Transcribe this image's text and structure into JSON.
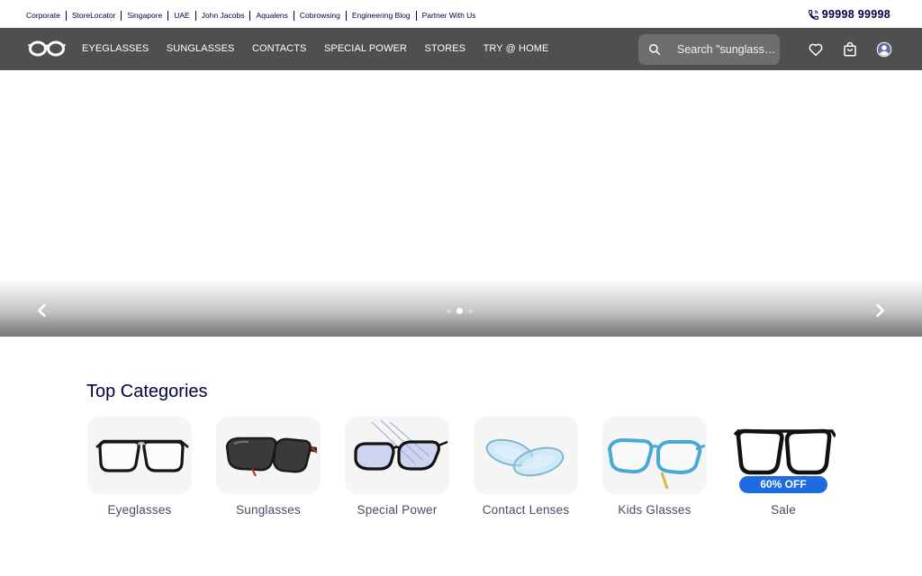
{
  "topbar": {
    "links": [
      "Corporate",
      "StoreLocator",
      "Singapore",
      "UAE",
      "John Jacobs",
      "Aqualens",
      "Cobrowsing",
      "Engineering Blog",
      "Partner With Us"
    ],
    "phone": "99998 99998"
  },
  "navbar": {
    "logo_icon": "glasses-logo-icon",
    "links": [
      "EYEGLASSES",
      "SUNGLASSES",
      "CONTACTS",
      "SPECIAL POWER",
      "STORES",
      "TRY @ HOME"
    ],
    "search_placeholder": "Search \"sunglasses\"",
    "icons": [
      "heart-icon",
      "shopping-bag-icon",
      "user-avatar-icon"
    ]
  },
  "carousel": {
    "slide_count": 3,
    "active_index": 1,
    "prev_icon": "chevron-left-icon",
    "next_icon": "chevron-right-icon"
  },
  "categories": {
    "title": "Top Categories",
    "items": [
      {
        "label": "Eyeglasses"
      },
      {
        "label": "Sunglasses"
      },
      {
        "label": "Special Power"
      },
      {
        "label": "Contact Lenses"
      },
      {
        "label": "Kids Glasses"
      },
      {
        "label": "Sale",
        "badge": "60% OFF"
      }
    ]
  },
  "colors": {
    "navy": "#000042",
    "navbar": "#4f4f4f",
    "sale_badge": "#1f6be0"
  }
}
